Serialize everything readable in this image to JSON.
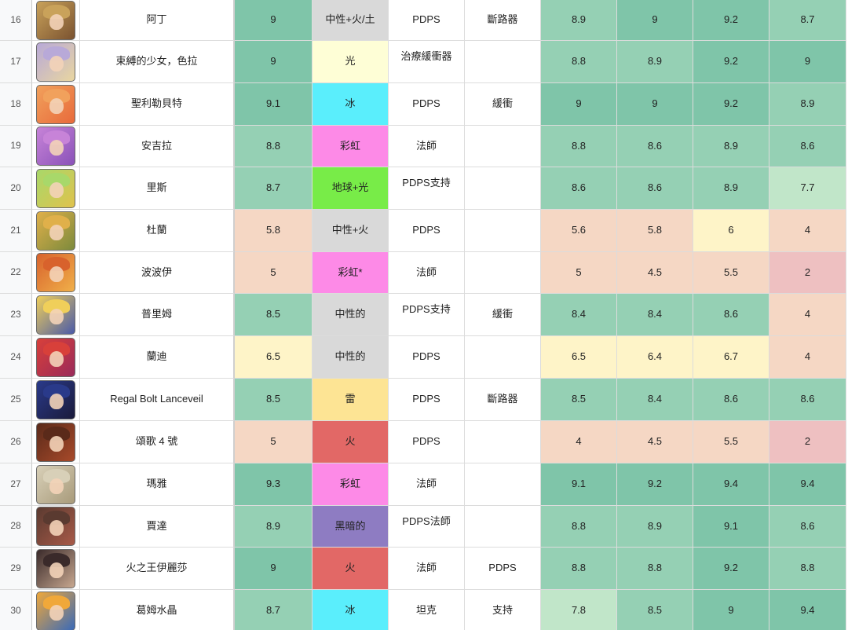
{
  "colors": {
    "score_top": "#7fc5a9",
    "score_high": "#95d0b4",
    "score_mid": "#c1e6c9",
    "score_yellow": "#fef4c8",
    "score_peach": "#f5d7c4",
    "score_pink": "#eec0c1",
    "elem_neutral": "#d9d9d9",
    "elem_light": "#fefed6",
    "elem_ice": "#5aeefc",
    "elem_rainbow": "#fd8ae7",
    "elem_earth": "#78ec48",
    "elem_thunder": "#fde494",
    "elem_fire": "#e26866",
    "elem_dark": "#8e7cc2"
  },
  "rows": [
    {
      "num": "16",
      "name": "阿丁",
      "score": "9",
      "element": "中性+火/土",
      "role": "PDPS",
      "sub": "斷路器",
      "s1": "8.9",
      "s2": "9",
      "s3": "9.2",
      "s4": "8.7",
      "icon": "character-portrait-icon",
      "avatar_colors": [
        "#c9a25a",
        "#7a5230"
      ]
    },
    {
      "num": "17",
      "name": "束縛的少女，色拉",
      "score": "9",
      "element": "光",
      "role": "治療緩衝器",
      "sub": "",
      "s1": "8.8",
      "s2": "8.9",
      "s3": "9.2",
      "s4": "9",
      "icon": "character-portrait-icon",
      "avatar_colors": [
        "#b8a9d8",
        "#e9d6a0"
      ]
    },
    {
      "num": "18",
      "name": "聖利勒貝特",
      "score": "9.1",
      "element": "冰",
      "role": "PDPS",
      "sub": "緩衝",
      "s1": "9",
      "s2": "9",
      "s3": "9.2",
      "s4": "8.9",
      "icon": "character-portrait-icon",
      "avatar_colors": [
        "#f1a15c",
        "#e86a3b"
      ]
    },
    {
      "num": "19",
      "name": "安吉拉",
      "score": "8.8",
      "element": "彩虹",
      "role": "法師",
      "sub": "",
      "s1": "8.8",
      "s2": "8.6",
      "s3": "8.9",
      "s4": "8.6",
      "icon": "character-portrait-icon",
      "avatar_colors": [
        "#c783d8",
        "#8a52b8"
      ]
    },
    {
      "num": "20",
      "name": "里斯",
      "score": "8.7",
      "element": "地球+光",
      "role": "PDPS支持",
      "sub": "",
      "s1": "8.6",
      "s2": "8.6",
      "s3": "8.9",
      "s4": "7.7",
      "icon": "character-portrait-icon",
      "avatar_colors": [
        "#a8d86a",
        "#e0c24c"
      ]
    },
    {
      "num": "21",
      "name": "杜蘭",
      "score": "5.8",
      "element": "中性+火",
      "role": "PDPS",
      "sub": "",
      "s1": "5.6",
      "s2": "5.8",
      "s3": "6",
      "s4": "4",
      "icon": "character-portrait-icon",
      "avatar_colors": [
        "#e0b04a",
        "#7c8a3c"
      ]
    },
    {
      "num": "22",
      "name": "波波伊",
      "score": "5",
      "element": "彩虹*",
      "role": "法師",
      "sub": "",
      "s1": "5",
      "s2": "4.5",
      "s3": "5.5",
      "s4": "2",
      "icon": "character-portrait-icon",
      "avatar_colors": [
        "#d8622c",
        "#f0b04a"
      ]
    },
    {
      "num": "23",
      "name": "普里姆",
      "score": "8.5",
      "element": "中性的",
      "role": "PDPS支持",
      "sub": "緩衝",
      "s1": "8.4",
      "s2": "8.4",
      "s3": "8.6",
      "s4": "4",
      "icon": "character-portrait-icon",
      "avatar_colors": [
        "#f0cf5a",
        "#4a5aa8"
      ]
    },
    {
      "num": "24",
      "name": "蘭迪",
      "score": "6.5",
      "element": "中性的",
      "role": "PDPS",
      "sub": "",
      "s1": "6.5",
      "s2": "6.4",
      "s3": "6.7",
      "s4": "4",
      "icon": "character-portrait-icon",
      "avatar_colors": [
        "#d8403a",
        "#9a2a5a"
      ]
    },
    {
      "num": "25",
      "name": "Regal Bolt Lanceveil",
      "score": "8.5",
      "element": "雷",
      "role": "PDPS",
      "sub": "斷路器",
      "s1": "8.5",
      "s2": "8.4",
      "s3": "8.6",
      "s4": "8.6",
      "icon": "character-portrait-icon",
      "avatar_colors": [
        "#2a3a8a",
        "#1a1a3a"
      ]
    },
    {
      "num": "26",
      "name": "頌歌 4 號",
      "score": "5",
      "element": "火",
      "role": "PDPS",
      "sub": "",
      "s1": "4",
      "s2": "4.5",
      "s3": "5.5",
      "s4": "2",
      "icon": "character-portrait-icon",
      "avatar_colors": [
        "#5a2a1a",
        "#a84a2a"
      ]
    },
    {
      "num": "27",
      "name": "瑪雅",
      "score": "9.3",
      "element": "彩虹",
      "role": "法師",
      "sub": "",
      "s1": "9.1",
      "s2": "9.2",
      "s3": "9.4",
      "s4": "9.4",
      "icon": "character-portrait-icon",
      "avatar_colors": [
        "#d8d0b8",
        "#a89a7a"
      ]
    },
    {
      "num": "28",
      "name": "賈達",
      "score": "8.9",
      "element": "黑暗的",
      "role": "PDPS法師",
      "sub": "",
      "s1": "8.8",
      "s2": "8.9",
      "s3": "9.1",
      "s4": "8.6",
      "icon": "character-portrait-icon",
      "avatar_colors": [
        "#5a3a30",
        "#a85a48"
      ]
    },
    {
      "num": "29",
      "name": "火之王伊麗莎",
      "score": "9",
      "element": "火",
      "role": "法師",
      "sub": "PDPS",
      "s1": "8.8",
      "s2": "8.8",
      "s3": "9.2",
      "s4": "8.8",
      "icon": "character-portrait-icon",
      "avatar_colors": [
        "#3a2a2a",
        "#c8a890"
      ]
    },
    {
      "num": "30",
      "name": "葛姆水晶",
      "score": "8.7",
      "element": "冰",
      "role": "坦克",
      "sub": "支持",
      "s1": "7.8",
      "s2": "8.5",
      "s3": "9",
      "s4": "9.4",
      "icon": "character-portrait-icon",
      "avatar_colors": [
        "#f0a83a",
        "#3a6ab8"
      ]
    }
  ]
}
